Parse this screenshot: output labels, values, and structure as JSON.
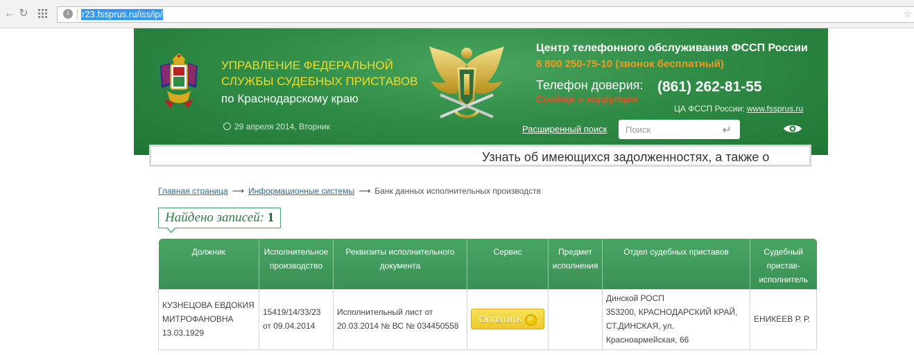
{
  "browser": {
    "url": "r23.fssprus.ru/iss/ip/"
  },
  "header": {
    "org_line1": "УПРАВЛЕНИЕ ФЕДЕРАЛЬНОЙ",
    "org_line2": "СЛУЖБЫ СУДЕБНЫХ ПРИСТАВОВ",
    "org_line3": "по Краснодарскому краю",
    "date": "29 апреля 2014, Вторник",
    "call_center": "Центр телефонного обслуживания ФССП России",
    "free_phone": "8 800 250-75-10 (звонок бесплатный)",
    "trust_label": "Телефон доверия:",
    "trust_phone": "(861) 262-81-55",
    "corruption_link": "Сообщи о коррупции",
    "central_label": "ЦА ФССП России:",
    "central_link": "www.fssprus.ru",
    "advanced_search": "Расширенный поиск",
    "search_placeholder": "Поиск"
  },
  "ticker": {
    "text": "Узнать об имеющихся задолженностях, а также о"
  },
  "breadcrumb": {
    "home": "Главная страница",
    "arrow": "⟶",
    "systems": "Информационные системы",
    "current": "Банк данных исполнительных производств"
  },
  "found": {
    "label": "Найдено записей:",
    "count": "1"
  },
  "table": {
    "headers": [
      "Должник",
      "Исполнительное производство",
      "Реквизиты исполнительного документа",
      "Сервис",
      "Предмет исполнения",
      "Отдел судебных приставов",
      "Судебный пристав-исполнитель"
    ],
    "row": {
      "debtor_line1": "КУЗНЕЦОВА ЕВДОКИЯ",
      "debtor_line2": "МИТРОФАНОВНА",
      "debtor_line3": "13.03.1929",
      "proceeding_line1": "15419/14/33/23",
      "proceeding_line2": "от 09.04.2014",
      "document_line1": "Исполнительный лист от",
      "document_line2": "20.03.2014 № ВС № 034450558",
      "service_button": "Оплатить",
      "ruble_sign": "Р",
      "subject": "",
      "department_line1": "Динской РОСП",
      "department_line2": "353200, КРАСНОДАРСКИЙ КРАЙ,",
      "department_line3": "СТ.ДИНСКАЯ, ул.",
      "department_line4": "Красноармейская, 66",
      "bailiff": "ЕНИКЕЕВ Р. Р."
    }
  },
  "colors": {
    "header_green": "#2f8c46",
    "title_yellow": "#f3dc2a",
    "phone_orange": "#f39a1f",
    "corruption_red": "#f04e23",
    "pay_yellow": "#f2d33d"
  }
}
